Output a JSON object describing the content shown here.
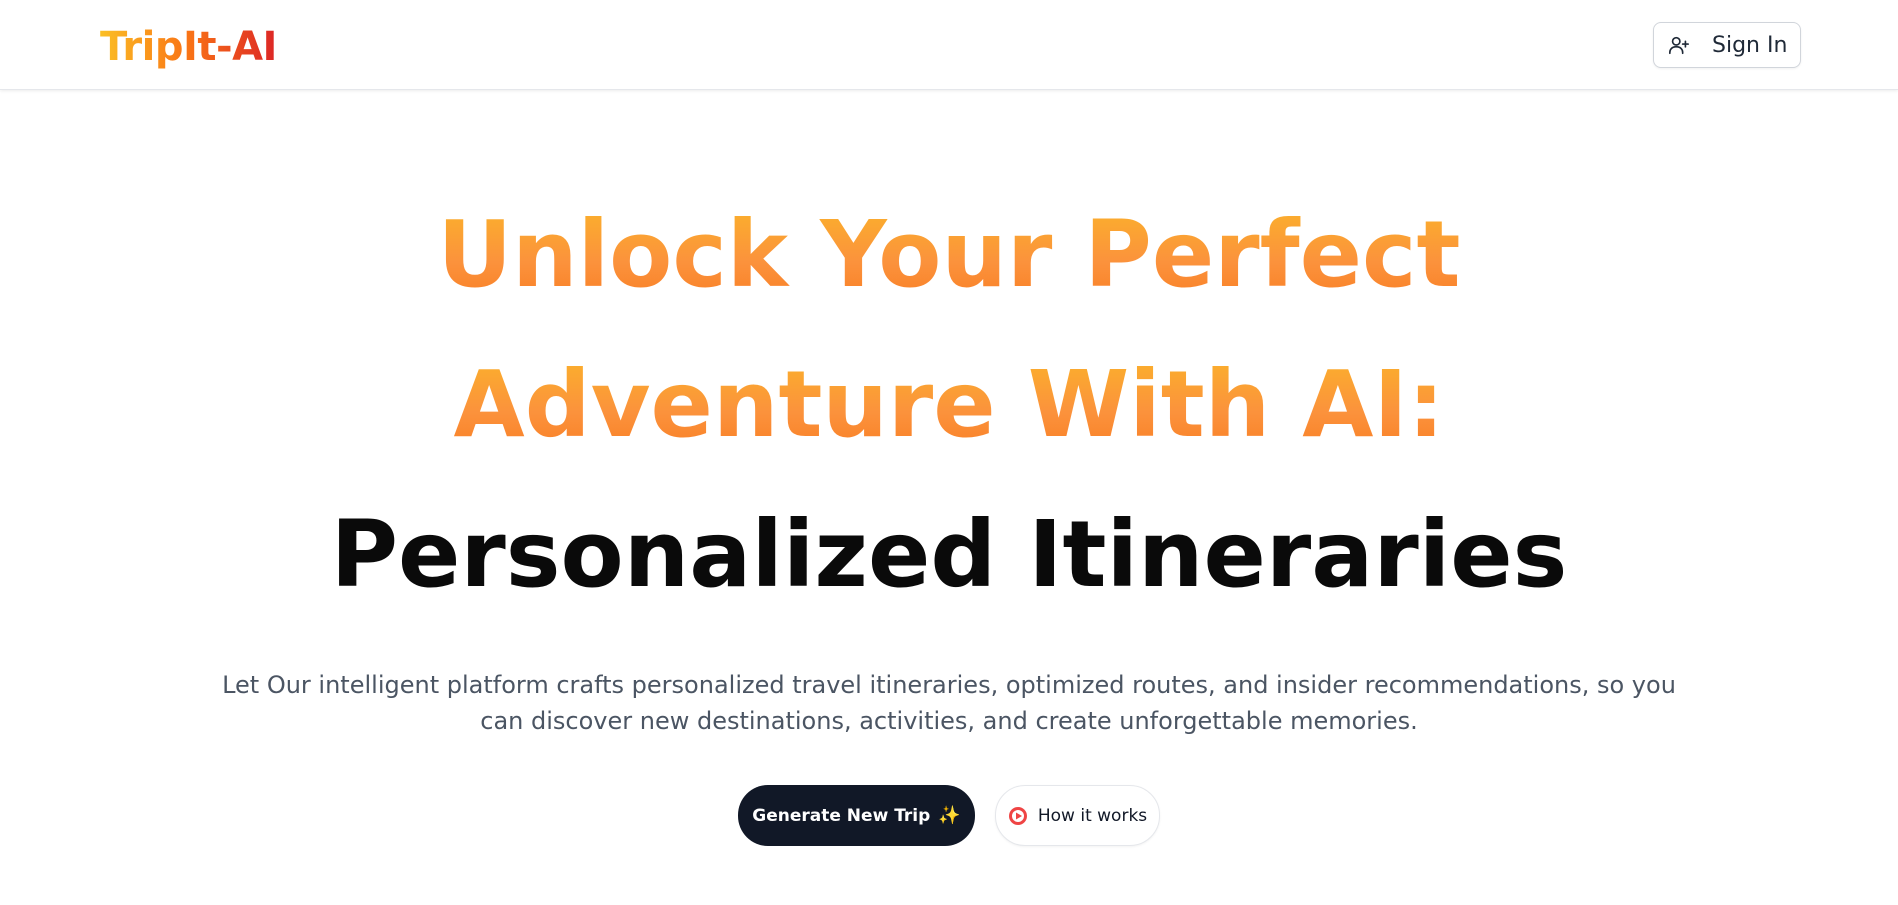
{
  "header": {
    "logo_text": "TripIt-AI",
    "signin": {
      "label": "Sign In",
      "icon": "user-plus-icon"
    }
  },
  "hero": {
    "headline_line1": "Unlock Your Perfect",
    "headline_line2": "Adventure With AI:",
    "headline_line3": "Personalized Itineraries",
    "subtext": "Let Our intelligent platform crafts personalized travel itineraries, optimized routes, and insider recommendations, so you can discover new destinations, activities, and create unforgettable memories."
  },
  "actions": {
    "primary_label": "Generate New Trip",
    "primary_emoji": "✨",
    "secondary_label": "How it works",
    "secondary_icon": "play-circle-icon"
  },
  "colors": {
    "gradient_start": "#fbbf24",
    "gradient_mid": "#f97316",
    "gradient_end": "#dc2626",
    "primary_button_bg": "#111827",
    "play_icon": "#ef4444"
  }
}
